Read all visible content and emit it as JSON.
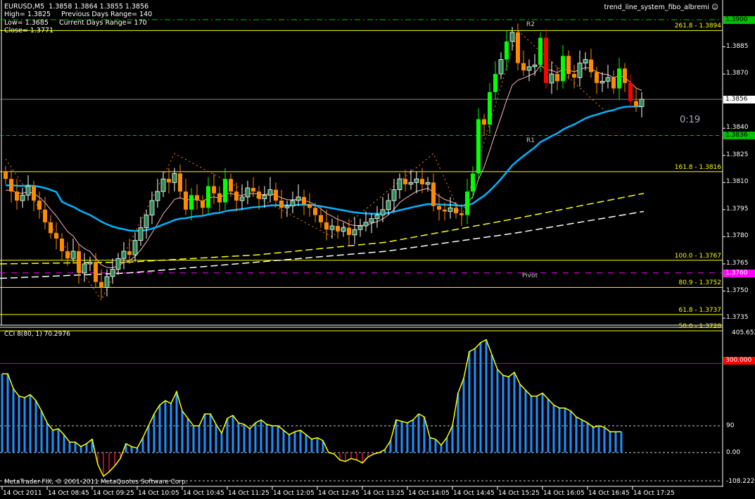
{
  "header": {
    "line1": "EURUSD,M5  1.3858 1.3864 1.3855 1.3856",
    "line2": "High= 1.3825     Previous Days Range= 140",
    "line3": "Low= 1.3685     Current Days Range= 170",
    "line4": "Close= 1.3771",
    "indicator_name": "trend_line_system_fibo_albremi ☺"
  },
  "levels": [
    {
      "price": 1.39,
      "label": "",
      "axis": "1.3900",
      "kind": "green"
    },
    {
      "price": 1.3894,
      "label": "261.8 - 1.3894",
      "kind": "fib"
    },
    {
      "price": 1.3856,
      "axis": "1.3856",
      "kind": "current"
    },
    {
      "price": 1.3836,
      "axis": "1.3836",
      "kind": "green"
    },
    {
      "price": 1.3816,
      "label": "161.8 - 1.3816",
      "kind": "fib"
    },
    {
      "price": 1.3767,
      "label": "100.0 - 1.3767",
      "kind": "fib"
    },
    {
      "price": 1.376,
      "axis": "1.3760",
      "kind": "pivot"
    },
    {
      "price": 1.3752,
      "label": "80.9 - 1.3752",
      "kind": "fib"
    },
    {
      "price": 1.3737,
      "label": "61.8 - 1.3737",
      "kind": "fib"
    },
    {
      "price": 1.3728,
      "label": "50.0 - 1.3728",
      "kind": "fib"
    }
  ],
  "pivot_labels": {
    "r2": "R2",
    "r1": "R1",
    "pivot": "Pivot"
  },
  "timer": "0:19",
  "price_axis": [
    "1.3885",
    "1.3870",
    "1.3840",
    "1.3825",
    "1.3810",
    "1.3795",
    "1.3780",
    "1.3765",
    "1.3750",
    "1.3735"
  ],
  "cci": {
    "title": "CCI 8(80, 1) 70.2976",
    "axis": {
      "max": "405.652",
      "level_high": "300.000",
      "level_mid": "90",
      "zero": "0.00",
      "min": "-108.222"
    },
    "footer": "MetaTrader-FIX, © 2001-2011 MetaQuotes Software Corp."
  },
  "time_axis": [
    "14 Oct 2011",
    "14 Oct 08:45",
    "14 Oct 09:25",
    "14 Oct 10:05",
    "14 Oct 10:45",
    "14 Oct 11:25",
    "14 Oct 12:05",
    "14 Oct 12:45",
    "14 Oct 13:25",
    "14 Oct 14:05",
    "14 Oct 14:45",
    "14 Oct 15:25",
    "14 Oct 16:05",
    "14 Oct 16:45",
    "14 Oct 17:25"
  ],
  "colors": {
    "bull": "#00ff00",
    "bull_small": "#2e8b57",
    "bear": "#ff8c00",
    "bear_red": "#ff0000",
    "fib": "#ffff00",
    "green_level": "#00c000",
    "pivot": "#ff00ff",
    "ma_fast": "#ffb6c1",
    "ma_mid": "#00b4ff",
    "cci_pos": "#1e90ff",
    "cci_neg": "#dc143c",
    "cci_line": "#ffff00"
  },
  "chart_data": [
    {
      "type": "candlestick",
      "title": "EURUSD,M5",
      "ylim": [
        1.3722,
        1.3911
      ],
      "closes": [
        1.3812,
        1.3805,
        1.38,
        1.3803,
        1.3808,
        1.38,
        1.3795,
        1.3788,
        1.3782,
        1.3779,
        1.3772,
        1.3768,
        1.3772,
        1.376,
        1.3765,
        1.3766,
        1.3755,
        1.3752,
        1.3758,
        1.3762,
        1.3768,
        1.3772,
        1.377,
        1.3778,
        1.3785,
        1.3792,
        1.38,
        1.3805,
        1.3812,
        1.381,
        1.3815,
        1.3805,
        1.3795,
        1.3803,
        1.38,
        1.3796,
        1.3808,
        1.3804,
        1.3799,
        1.3812,
        1.3805,
        1.38,
        1.3802,
        1.3807,
        1.3805,
        1.3801,
        1.3803,
        1.3806,
        1.38,
        1.3796,
        1.3797,
        1.38,
        1.3802,
        1.3798,
        1.3796,
        1.3792,
        1.3788,
        1.3784,
        1.3786,
        1.3783,
        1.3785,
        1.3781,
        1.3784,
        1.3786,
        1.3788,
        1.379,
        1.3792,
        1.3795,
        1.38,
        1.3806,
        1.3812,
        1.3809,
        1.381,
        1.3812,
        1.3809,
        1.381,
        1.3797,
        1.3795,
        1.3794,
        1.3796,
        1.3793,
        1.3792,
        1.3805,
        1.3815,
        1.3845,
        1.3842,
        1.386,
        1.387,
        1.3878,
        1.3888,
        1.3893,
        1.3876,
        1.3872,
        1.3874,
        1.3875,
        1.389,
        1.3865,
        1.387,
        1.3866,
        1.388,
        1.387,
        1.3868,
        1.3876,
        1.3878,
        1.3871,
        1.3865,
        1.3866,
        1.3868,
        1.3862,
        1.3873,
        1.3865,
        1.3855,
        1.3852,
        1.3856
      ],
      "slow_ma_yellow": [
        1.3765,
        1.3766,
        1.377,
        1.3777,
        1.379,
        1.3804
      ],
      "slow_ma_white": [
        1.3757,
        1.376,
        1.3766,
        1.3772,
        1.3782,
        1.3794
      ],
      "zigzag": [
        [
          0,
          1.3823
        ],
        [
          17,
          1.3745
        ],
        [
          30,
          1.3826
        ],
        [
          58,
          1.378
        ],
        [
          76,
          1.3826
        ],
        [
          81,
          1.3791
        ],
        [
          91,
          1.3894
        ],
        [
          107,
          1.3848
        ]
      ]
    },
    {
      "type": "bar",
      "title": "CCI 8(80, 1)",
      "ylim": [
        -108.222,
        405.652
      ],
      "levels": [
        300,
        90,
        0
      ],
      "values": [
        265,
        265,
        215,
        190,
        185,
        195,
        175,
        140,
        100,
        75,
        80,
        60,
        35,
        35,
        20,
        30,
        45,
        -40,
        -80,
        -65,
        -45,
        -20,
        30,
        20,
        15,
        50,
        90,
        130,
        160,
        175,
        165,
        205,
        140,
        115,
        90,
        90,
        130,
        130,
        95,
        65,
        115,
        125,
        100,
        95,
        80,
        100,
        110,
        95,
        90,
        90,
        75,
        60,
        70,
        75,
        60,
        45,
        50,
        40,
        0,
        -5,
        -25,
        -30,
        -20,
        -25,
        -35,
        -15,
        -5,
        0,
        10,
        40,
        110,
        105,
        100,
        110,
        130,
        120,
        50,
        45,
        25,
        50,
        90,
        200,
        250,
        340,
        350,
        370,
        380,
        330,
        280,
        260,
        255,
        270,
        230,
        210,
        190,
        190,
        200,
        180,
        160,
        150,
        150,
        140,
        120,
        110,
        100,
        85,
        90,
        85,
        70,
        70,
        70
      ]
    }
  ]
}
